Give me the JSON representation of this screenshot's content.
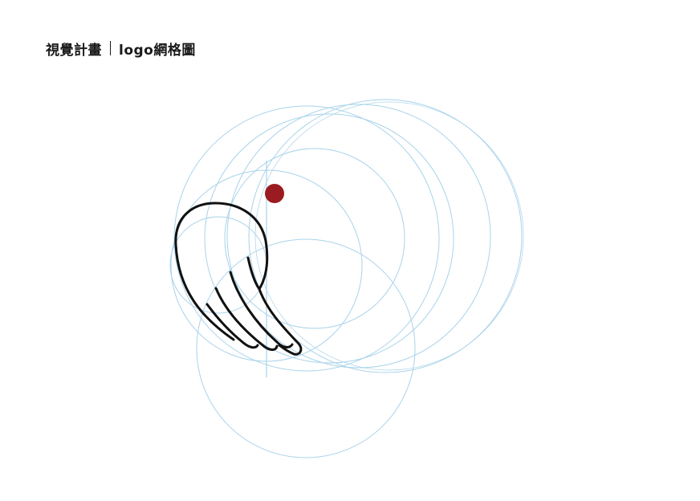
{
  "header": {
    "project": "視覺計畫",
    "sheet": "logo網格圖"
  },
  "colors": {
    "grid_line": "#a9d3ea",
    "logo_stroke": "#111111",
    "dot": "#9b1c20",
    "background": "#ffffff"
  }
}
